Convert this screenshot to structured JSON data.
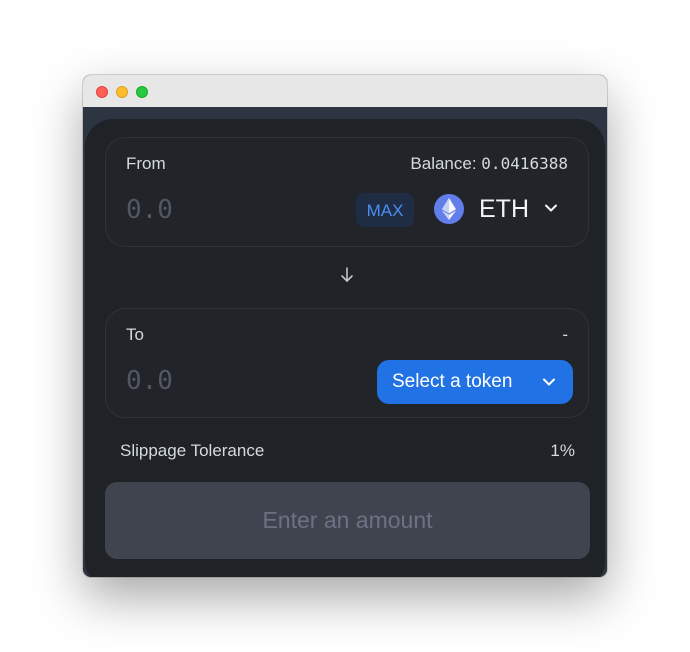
{
  "window": {
    "controls": [
      "close",
      "minimize",
      "zoom"
    ]
  },
  "swap": {
    "from": {
      "label": "From",
      "balance_label": "Balance: ",
      "balance_value": "0.0416388",
      "amount_placeholder": "0.0",
      "amount_value": "",
      "max_label": "MAX",
      "token_symbol": "ETH",
      "token_icon": "ethereum-icon"
    },
    "switch_icon": "arrow-down-icon",
    "to": {
      "label": "To",
      "balance_placeholder": "-",
      "amount_placeholder": "0.0",
      "amount_value": "",
      "select_token_label": "Select a token"
    },
    "slippage": {
      "label": "Slippage Tolerance",
      "value": "1%"
    },
    "submit_label": "Enter an amount"
  },
  "colors": {
    "card_background": "#1f2227",
    "panel_border": "#2e323a",
    "accent_blue": "#2172e5",
    "max_text": "#4a8ff0",
    "disabled_button": "#40444f",
    "eth_purple": "#627eea"
  }
}
